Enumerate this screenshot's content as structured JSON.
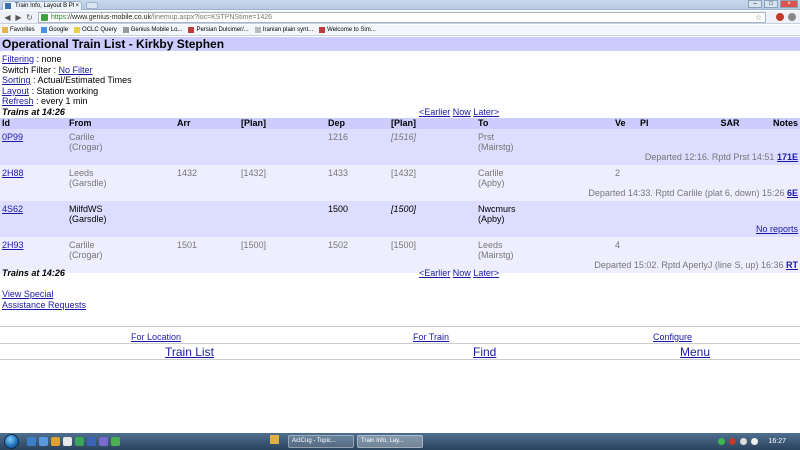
{
  "browser": {
    "tab_title": "Train Info, Layout B PI",
    "address_https": "https",
    "address_host": "://www.genius-mobile.co.uk",
    "address_path": "/linemup.aspx?loc=KSTPNStime=1426",
    "bookmarks": [
      {
        "label": "Favorites",
        "color": "#e8b44a"
      },
      {
        "label": "Google",
        "color": "#4a8fe8"
      },
      {
        "label": "OCLC Query",
        "color": "#e8d24a"
      },
      {
        "label": "Genius Mobile Lo...",
        "color": "#9a9a9a"
      },
      {
        "label": "Persian Dulcimer/...",
        "color": "#c03b3b"
      },
      {
        "label": "Iranian plain synt...",
        "color": "#bbbbbb"
      },
      {
        "label": "Welcome to Sim...",
        "color": "#c03b3b"
      }
    ]
  },
  "page": {
    "title": "Operational Train List - Kirkby Stephen",
    "options": {
      "filtering_label": "Filtering",
      "filtering_value": ": none",
      "switch_label": "Switch Filter :",
      "switch_link": "No Filter",
      "sorting_label": "Sorting",
      "sorting_value": ": Actual/Estimated Times",
      "layout_label": "Layout",
      "layout_value": ": Station working",
      "refresh_label": "Refresh",
      "refresh_value": ": every 1 min"
    },
    "trains_at": "Trains at 14:26",
    "nav": {
      "earlier": "<Earlier",
      "now": "Now",
      "later": "Later>"
    },
    "columns": {
      "id": "Id",
      "from": "From",
      "arr": "Arr",
      "plan1": "[Plan]",
      "dep": "Dep",
      "plan2": "[Plan]",
      "to": "To",
      "ve": "Ve",
      "pl": "Pl",
      "sar": "SAR",
      "notes": "Notes"
    },
    "trains": [
      {
        "id": "0P99",
        "from": "Carlile",
        "from_sub": "(Crogar)",
        "arr": "",
        "plan_arr": "",
        "dep": "1216",
        "plan_dep": "[1516]",
        "to": "Prst",
        "to_sub": "(Mairstg)",
        "ve": "",
        "report": "Departed 12:16. Rptd Prst 14:51",
        "report_link": "171E"
      },
      {
        "id": "2H88",
        "from": "Leeds",
        "from_sub": "(Garsdle)",
        "arr": "1432",
        "plan_arr": "[1432]",
        "dep": "1433",
        "plan_dep": "[1432]",
        "to": "Carlile",
        "to_sub": "(Apby)",
        "ve": "2",
        "report": "Departed 14:33. Rptd Carlile (plat 6, down) 15:26",
        "report_link": "6E"
      },
      {
        "id": "4S62",
        "from": "MilfdWS",
        "from_sub": "(Garsdle)",
        "arr": "",
        "plan_arr": "",
        "dep": "1500",
        "plan_dep": "[1500]",
        "to": "Nwcmurs",
        "to_sub": "(Apby)",
        "ve": "",
        "report": "",
        "report_link": "No reports"
      },
      {
        "id": "2H93",
        "from": "Carlile",
        "from_sub": "(Crogar)",
        "arr": "1501",
        "plan_arr": "[1500]",
        "dep": "1502",
        "plan_dep": "[1500]",
        "to": "Leeds",
        "to_sub": "(Mairstg)",
        "ve": "4",
        "report": "Departed 15:02. Rptd AperlyJ (line S, up) 16:36",
        "report_link": "RT"
      }
    ],
    "links": {
      "view_special": "View Special",
      "assistance": "Assistance Requests"
    },
    "footer1": {
      "for_location": "For Location",
      "for_train": "For Train",
      "configure": "Configure"
    },
    "footer2": {
      "train_list": "Train List",
      "find": "Find",
      "menu": "Menu"
    }
  },
  "taskbar": {
    "tasks": [
      "ActCug - Topic...",
      "Train Info, Lay..."
    ],
    "clock": "16:27"
  }
}
